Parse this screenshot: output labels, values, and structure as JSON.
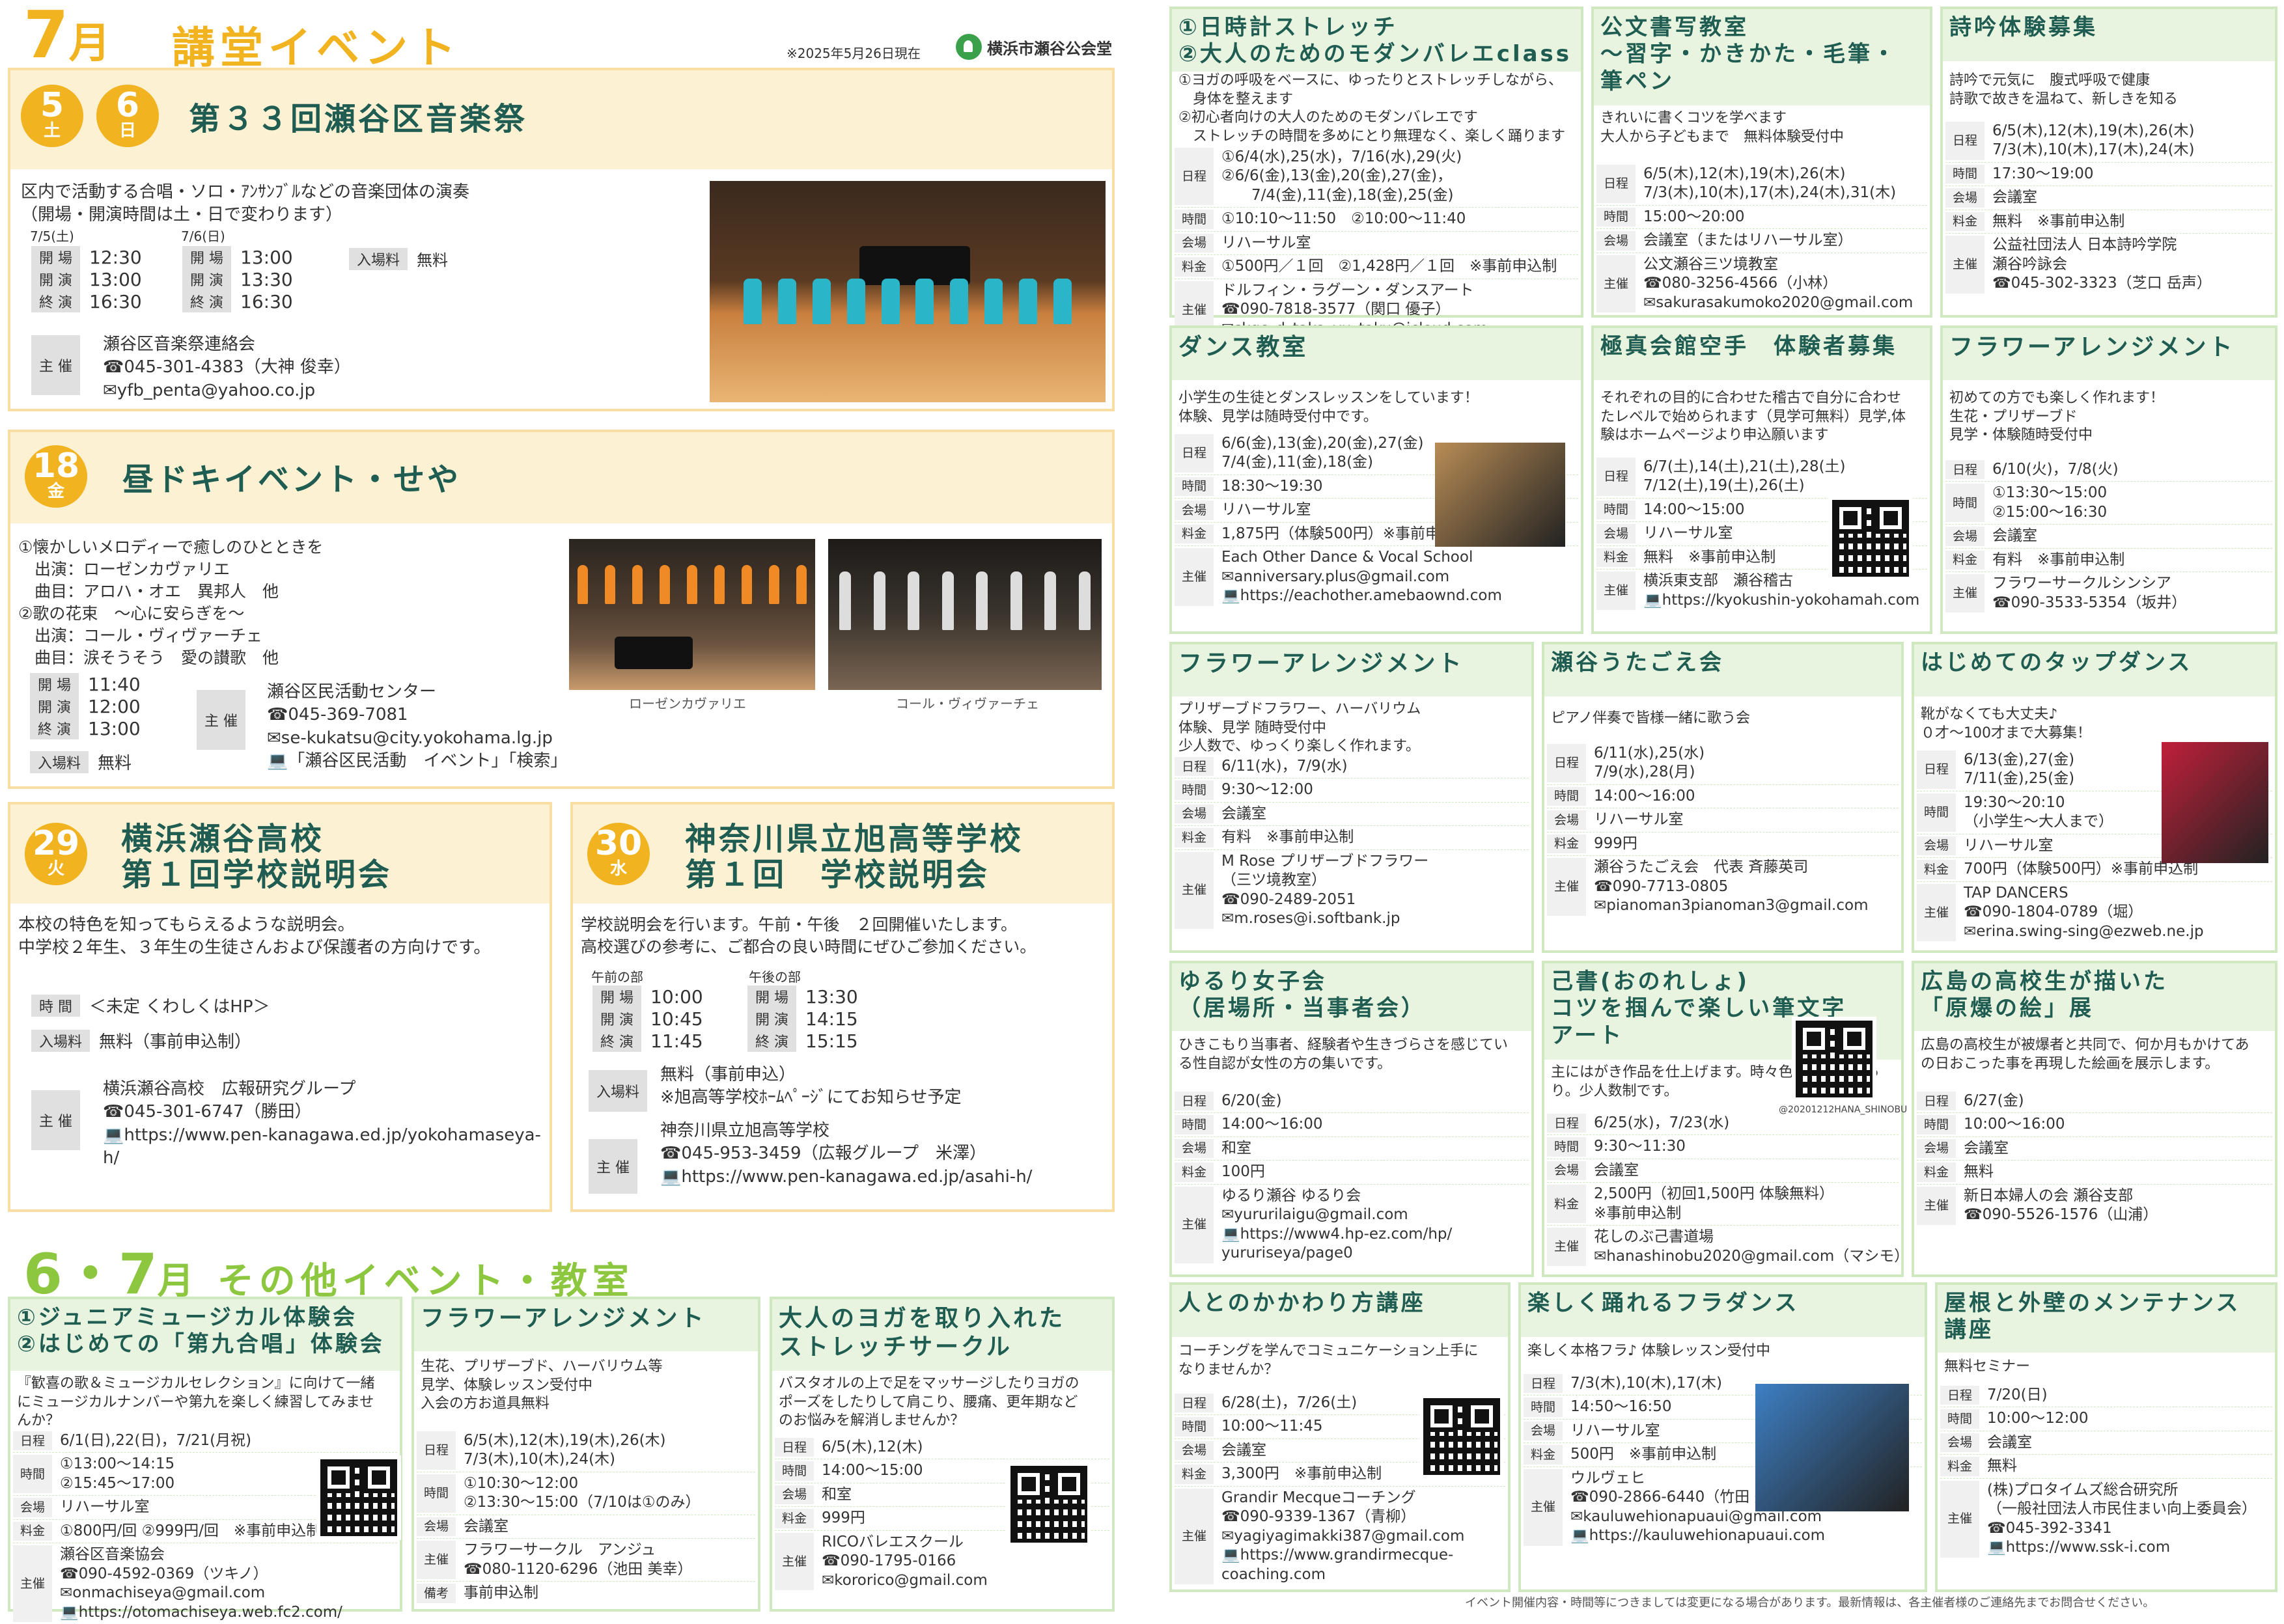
{
  "header": {
    "month": "7",
    "month_unit": "月",
    "title": "講堂イベント",
    "as_of": "※2025年5月26日現在",
    "logo": "横浜市瀬谷公会堂"
  },
  "ev1": {
    "day1": "5",
    "wd1": "土",
    "day2": "6",
    "wd2": "日",
    "title": "第３３回瀬谷区音楽祭",
    "desc": "区内で活動する合唱・ソロ・ｱﾝｻﾝﾌﾞﾙなどの音楽団体の演奏\n（開場・開演時間は土・日で変わります）",
    "d1": "7/5(土)",
    "d2": "7/6(日)",
    "lbl_open": "開 場",
    "lbl_start": "開 演",
    "lbl_end": "終 演",
    "t1": [
      "12:30",
      "13:00",
      "16:30"
    ],
    "t2": [
      "13:00",
      "13:30",
      "16:30"
    ],
    "fee_lbl": "入場料",
    "fee": "無料",
    "org_lbl": "主 催",
    "org": "瀬谷区音楽祭連絡会\n☎045-301-4383（大神 俊幸）\n✉yfb_penta@yahoo.co.jp"
  },
  "ev2": {
    "day": "18",
    "wd": "金",
    "title": "昼ドキイベント・せや",
    "desc": "①懐かしいメロディーで癒しのひとときを\n　出演：ローゼンカヴァリエ\n　曲目：アロハ・オエ　異邦人　他\n②歌の花束　～心に安らぎを～\n　出演：コール・ヴィヴァーチェ\n　曲目：涙そうそう　愛の讃歌　他",
    "times": [
      "11:40",
      "12:00",
      "13:00"
    ],
    "fee": "無料",
    "org": "瀬谷区民活動センター\n☎045-369-7081\n✉se-kukatsu@city.yokohama.lg.jp\n💻「瀬谷区民活動　イベント」「検索」",
    "cap1": "ローゼンカヴァリエ",
    "cap2": "コール・ヴィヴァーチェ"
  },
  "ev3": {
    "day": "29",
    "wd": "火",
    "title": "横浜瀬谷高校\n第１回学校説明会",
    "desc": "本校の特色を知ってもらえるような説明会。\n中学校２年生、３年生の生徒さんおよび保護者の方向けです。",
    "time_lbl": "時 間",
    "time": "＜未定 くわしくはHP＞",
    "fee_lbl": "入場料",
    "fee": "無料（事前申込制）",
    "org": "横浜瀬谷高校　広報研究グループ\n☎045-301-6747（勝田）\n💻https://www.pen-kanagawa.ed.jp/yokohamaseya-\nh/"
  },
  "ev4": {
    "day": "30",
    "wd": "水",
    "title": "神奈川県立旭高等学校\n第１回　学校説明会",
    "desc": "学校説明会を行います。午前・午後　２回開催いたします。\n高校選びの参考に、ご都合の良い時間にぜひご参加ください。",
    "am": "午前の部",
    "pm": "午後の部",
    "t_am": [
      "10:00",
      "10:45",
      "11:45"
    ],
    "t_pm": [
      "13:30",
      "14:15",
      "15:15"
    ],
    "fee": "無料（事前申込）\n※旭高等学校ﾎｰﾑﾍﾟｰｼﾞにてお知らせ予定",
    "org": "神奈川県立旭高等学校\n☎045-953-3459（広報グループ　米澤）\n💻https://www.pen-kanagawa.ed.jp/asahi-h/"
  },
  "section2": {
    "months": "6・7",
    "unit": "月",
    "title": "その他イベント・教室"
  },
  "labels": {
    "date": "日程",
    "time": "時間",
    "place": "会場",
    "fee": "料金",
    "org": "主催",
    "note": "備考"
  },
  "boxes": [
    {
      "title": "①ジュニアミュージカル体験会\n②はじめての「第九合唱」体験会",
      "desc": "『歓喜の歌＆ミュージカルセレクション』に向けて一緒\nにミュージカルナンバーや第九を楽しく練習してみませ\nんか？",
      "rows": [
        [
          "date",
          "6/1(日),22(日)，7/21(月祝)"
        ],
        [
          "time",
          "①13:00～14:15\n②15:45～17:00"
        ],
        [
          "place",
          "リハーサル室"
        ],
        [
          "fee",
          "①800円/回 ②999円/回　※事前申込制"
        ],
        [
          "org",
          "瀬谷区音楽協会\n☎090-4592-0369（ツキノ）\n✉onmachiseya@gmail.com\n💻https://otomachiseya.web.fc2.com/"
        ]
      ]
    },
    {
      "title": "フラワーアレンジメント",
      "desc": "生花、プリザーブド、ハーバリウム等\n見学、体験レッスン受付中\n入会の方お道具無料",
      "rows": [
        [
          "date",
          "6/5(木),12(木),19(木),26(木)\n7/3(木),10(木),24(木)"
        ],
        [
          "time",
          "①10:30～12:00\n②13:30～15:00（7/10は①のみ）"
        ],
        [
          "place",
          "会議室"
        ],
        [
          "org",
          "フラワーサークル　アンジュ\n☎080-1120-6296（池田 美幸）"
        ],
        [
          "note",
          "事前申込制"
        ]
      ]
    },
    {
      "title": "大人のヨガを取り入れた\nストレッチサークル",
      "desc": "バスタオルの上で足をマッサージしたりヨガの\nポーズをしたりして肩こり、腰痛、更年期など\nのお悩みを解消しませんか？",
      "rows": [
        [
          "date",
          "6/5(木),12(木)"
        ],
        [
          "time",
          "14:00～15:00"
        ],
        [
          "place",
          "和室"
        ],
        [
          "fee",
          "999円"
        ],
        [
          "org",
          "RICOバレエスクール\n☎090-1795-0166\n✉kororico@gmail.com"
        ]
      ]
    },
    {
      "title": "①日時計ストレッチ\n②大人のためのモダンバレエclass",
      "desc": "①ヨガの呼吸をベースに、ゆったりとストレッチしながら、\n　身体を整えます\n②初心者向けの大人のためのモダンバレエです\n　ストレッチの時間を多めにとり無理なく、楽しく踊ります",
      "rows": [
        [
          "date",
          "①6/4(水),25(水)，7/16(水),29(火)\n②6/6(金),13(金),20(金),27(金)，\n　　7/4(金),11(金),18(金),25(金)"
        ],
        [
          "time",
          "①10:10～11:50　②10:00～11:40"
        ],
        [
          "place",
          "リハーサル室"
        ],
        [
          "fee",
          "①500円／１回　②1,428円／１回　※事前申込制"
        ],
        [
          "org",
          "ドルフィン・ラグーン・ダンスアート\n☎090-7818-3577（関口 優子）\n✉skgc_d_taka_yu_taku@icloud.com"
        ]
      ]
    },
    {
      "title": "公文書写教室\n～習字・かきかた・毛筆・\n筆ペン",
      "desc": "きれいに書くコツを学べます\n大人から子どもまで　無料体験受付中",
      "rows": [
        [
          "date",
          "6/5(木),12(木),19(木),26(木)\n7/3(木),10(木),17(木),24(木),31(木)"
        ],
        [
          "time",
          "15:00～20:00"
        ],
        [
          "place",
          "会議室（またはリハーサル室）"
        ],
        [
          "org",
          "公文瀬谷三ツ境教室\n☎080-3256-4566（小林）\n✉sakurasakumoko2020@gmail.com"
        ]
      ]
    },
    {
      "title": "詩吟体験募集",
      "desc": "詩吟で元気に　腹式呼吸で健康\n詩歌で故きを温ねて、新しきを知る",
      "rows": [
        [
          "date",
          "6/5(木),12(木),19(木),26(木)\n7/3(木),10(木),17(木),24(木)"
        ],
        [
          "time",
          "17:30～19:00"
        ],
        [
          "place",
          "会議室"
        ],
        [
          "fee",
          "無料　※事前申込制"
        ],
        [
          "org",
          "公益社団法人 日本詩吟学院\n瀬谷吟詠会\n☎045-302-3323（芝口 岳声）"
        ]
      ]
    },
    {
      "title": "ダンス教室",
      "desc": "小学生の生徒とダンスレッスンをしています！\n体験、見学は随時受付中です。",
      "rows": [
        [
          "date",
          "6/6(金),13(金),20(金),27(金)\n7/4(金),11(金),18(金)"
        ],
        [
          "time",
          "18:30～19:30"
        ],
        [
          "place",
          "リハーサル室"
        ],
        [
          "fee",
          "1,875円（体験500円）※事前申込制"
        ],
        [
          "org",
          "Each Other Dance & Vocal School\n✉anniversary.plus@gmail.com\n💻https://eachother.amebaownd.com"
        ]
      ]
    },
    {
      "title": "極真会館空手　体験者募集",
      "desc": "それぞれの目的に合わせた稽古で自分に合わせ\nたレベルで始められます（見学可無料）見学,体\n験はホームページより申込願います",
      "rows": [
        [
          "date",
          "6/7(土),14(土),21(土),28(土)\n7/12(土),19(土),26(土)"
        ],
        [
          "time",
          "14:00～15:00"
        ],
        [
          "place",
          "リハーサル室"
        ],
        [
          "fee",
          "無料　※事前申込制"
        ],
        [
          "org",
          "横浜東支部　瀬谷稽古\n💻https://kyokushin-yokohamah.com"
        ]
      ]
    },
    {
      "title": "フラワーアレンジメント",
      "desc": "初めての方でも楽しく作れます！\n生花・プリザーブド\n見学・体験随時受付中",
      "rows": [
        [
          "date",
          "6/10(火)，7/8(火)"
        ],
        [
          "time",
          "①13:30～15:00\n②15:00～16:30"
        ],
        [
          "place",
          "会議室"
        ],
        [
          "fee",
          "有料　※事前申込制"
        ],
        [
          "org",
          "フラワーサークルシンシア\n☎090-3533-5354（坂井）"
        ]
      ]
    },
    {
      "title": "フラワーアレンジメント",
      "desc": "プリザーブドフラワー、ハーバリウム\n体験、見学 随時受付中\n少人数で、ゆっくり楽しく作れます。",
      "rows": [
        [
          "date",
          "6/11(水)，7/9(水)"
        ],
        [
          "time",
          "9:30～12:00"
        ],
        [
          "place",
          "会議室"
        ],
        [
          "fee",
          "有料　※事前申込制"
        ],
        [
          "org",
          "M Rose プリザーブドフラワー\n（三ツ境教室）\n☎090-2489-2051\n✉m.roses@i.softbank.jp"
        ]
      ]
    },
    {
      "title": "瀬谷うたごえ会",
      "desc": "ピアノ伴奏で皆様一緒に歌う会",
      "rows": [
        [
          "date",
          "6/11(水),25(水)\n7/9(水),28(月)"
        ],
        [
          "time",
          "14:00～16:00"
        ],
        [
          "place",
          "リハーサル室"
        ],
        [
          "fee",
          "999円"
        ],
        [
          "org",
          "瀬谷うたごえ会　代表 斉藤英司\n☎090-7713-0805\n✉pianoman3pianoman3@gmail.com"
        ]
      ]
    },
    {
      "title": "はじめてのタップダンス",
      "desc": "靴がなくても大丈夫♪\n０才～100才まで大募集！",
      "rows": [
        [
          "date",
          "6/13(金),27(金)\n7/11(金),25(金)"
        ],
        [
          "time",
          "19:30～20:10\n（小学生～大人まで）"
        ],
        [
          "place",
          "リハーサル室"
        ],
        [
          "fee",
          "700円（体験500円）※事前申込制"
        ],
        [
          "org",
          "TAP DANCERS\n☎090-1804-0789（堀）\n✉erina.swing-sing@ezweb.ne.jp"
        ]
      ]
    },
    {
      "title": "ゆるり女子会\n（居場所・当事者会）",
      "desc": "ひきこもり当事者、経験者や生きづらさを感じてい\nる性自認が女性の方の集いです。",
      "rows": [
        [
          "date",
          "6/20(金)"
        ],
        [
          "time",
          "14:00～16:00"
        ],
        [
          "place",
          "和室"
        ],
        [
          "fee",
          "100円"
        ],
        [
          "org",
          "ゆるり瀬谷 ゆるり会\n✉yururilaigu@gmail.com\n💻https://www4.hp-ez.com/hp/\nyururiseya/page0"
        ]
      ]
    },
    {
      "title": "己書(おのれしょ)\nコツを掴んで楽しい筆文字\nアート",
      "desc": "主にはがき作品を仕上げます。時々色紙の大作もあ\nり。少人数制です。",
      "rows": [
        [
          "date",
          "6/25(水)，7/23(水)"
        ],
        [
          "time",
          "9:30～11:30"
        ],
        [
          "place",
          "会議室"
        ],
        [
          "fee",
          "2,500円（初回1,500円 体験無料）\n※事前申込制"
        ],
        [
          "org",
          "花しのぶ己書道場\n✉hanashinobu2020@gmail.com（マシモ）"
        ]
      ]
    },
    {
      "title": "広島の高校生が描いた\n「原爆の絵」展",
      "desc": "広島の高校生が被爆者と共同で、何か月もかけてあ\nの日おこった事を再現した絵画を展示します。",
      "rows": [
        [
          "date",
          "6/27(金)"
        ],
        [
          "time",
          "10:00～16:00"
        ],
        [
          "place",
          "会議室"
        ],
        [
          "fee",
          "無料"
        ],
        [
          "org",
          "新日本婦人の会 瀬谷支部\n☎090-5526-1576（山浦）"
        ]
      ]
    },
    {
      "title": "人とのかかわり方講座",
      "desc": "コーチングを学んでコミュニケーション上手に\nなりませんか？",
      "rows": [
        [
          "date",
          "6/28(土)，7/26(土)"
        ],
        [
          "time",
          "10:00～11:45"
        ],
        [
          "place",
          "会議室"
        ],
        [
          "fee",
          "3,300円　※事前申込制"
        ],
        [
          "org",
          "Grandir Mecqueコーチング\n☎090-9339-1367（青柳）\n✉yagiyagimakki387@gmail.com\n💻https://www.grandirmecque-\ncoaching.com"
        ]
      ]
    },
    {
      "title": "楽しく踊れるフラダンス",
      "desc": "楽しく本格フラ♪ 体験レッスン受付中",
      "rows": [
        [
          "date",
          "7/3(木),10(木),17(木)"
        ],
        [
          "time",
          "14:50～16:50"
        ],
        [
          "place",
          "リハーサル室"
        ],
        [
          "fee",
          "500円　※事前申込制"
        ],
        [
          "org",
          "ウルヴェヒ\n☎090-2866-6440（竹田 美穂）\n✉kauluwehionapuaui@gmail.com\n💻https://kauluwehionapuaui.com"
        ]
      ]
    },
    {
      "title": "屋根と外壁のメンテナンス\n講座",
      "desc": "無料セミナー",
      "rows": [
        [
          "date",
          "7/20(日)"
        ],
        [
          "time",
          "10:00～12:00"
        ],
        [
          "place",
          "会議室"
        ],
        [
          "fee",
          "無料"
        ],
        [
          "org",
          "(株)プロタイムズ総合研究所\n（一般社団法人市民住まい向上委員会）\n☎045-392-3341\n💻https://www.ssk-i.com"
        ]
      ]
    }
  ],
  "qr_caption": "@20201212HANA_SHINOBU",
  "footnote": "イベント開催内容・時間等につきましては変更になる場合があります。最新情報は、各主催者様のご連絡先までお問合せください。"
}
